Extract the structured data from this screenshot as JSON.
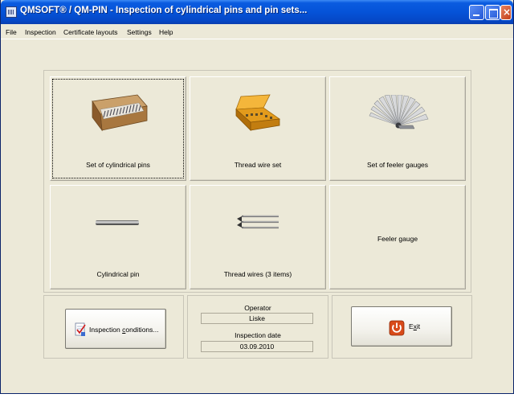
{
  "window": {
    "title": "QMSOFT® / QM-PIN - Inspection of cylindrical pins and pin sets..."
  },
  "menu": [
    "File",
    "Inspection",
    "Certificate layouts",
    "Settings",
    "Help"
  ],
  "tiles": [
    {
      "label": "Set of cylindrical pins",
      "icon": "pin-set-case-icon"
    },
    {
      "label": "Thread wire set",
      "icon": "thread-wire-set-case-icon"
    },
    {
      "label": "Set of feeler gauges",
      "icon": "feeler-gauge-fan-icon"
    },
    {
      "label": "Cylindrical pin",
      "icon": "cylindrical-pin-icon"
    },
    {
      "label": "Thread wires (3 items)",
      "icon": "thread-wires-icon"
    },
    {
      "label": "Feeler gauge"
    }
  ],
  "conditions_button": {
    "label_pre": "Inspection ",
    "label_mnemonic": "c",
    "label_post": "onditions...",
    "icon": "checklist-icon"
  },
  "operator": {
    "label": "Operator",
    "value": "Liske"
  },
  "inspection_date": {
    "label": "Inspection date",
    "value": "03.09.2010"
  },
  "exit_button": {
    "label_pre": "E",
    "label_mnemonic": "x",
    "label_post": "it",
    "icon": "power-icon",
    "icon_color": "#d84a1a"
  }
}
